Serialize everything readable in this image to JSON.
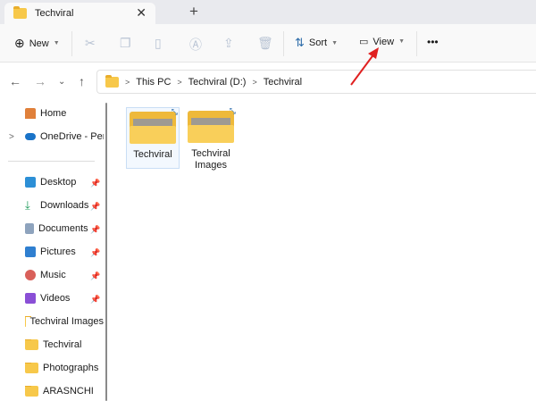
{
  "tab": {
    "title": "Techviral",
    "close": "✕",
    "new_tab": "+"
  },
  "toolbar": {
    "new": "New",
    "sort": "Sort",
    "view": "View",
    "more": "•••"
  },
  "address": {
    "path": [
      "This PC",
      "Techviral (D:)",
      "Techviral"
    ]
  },
  "sidebar": {
    "items": [
      {
        "label": "Home",
        "icon": "home-icon",
        "pinned": false
      },
      {
        "label": "OneDrive - Personal",
        "icon": "cloud-icon",
        "pinned": false
      },
      {
        "label": "Desktop",
        "icon": "desktop-icon",
        "pinned": true
      },
      {
        "label": "Downloads",
        "icon": "download-icon",
        "pinned": true
      },
      {
        "label": "Documents",
        "icon": "document-icon",
        "pinned": true
      },
      {
        "label": "Pictures",
        "icon": "pictures-icon",
        "pinned": true
      },
      {
        "label": "Music",
        "icon": "music-icon",
        "pinned": true
      },
      {
        "label": "Videos",
        "icon": "videos-icon",
        "pinned": true
      },
      {
        "label": "Techviral Images",
        "icon": "folder-icon",
        "pinned": false
      },
      {
        "label": "Techviral",
        "icon": "folder-icon",
        "pinned": false
      },
      {
        "label": "Photographs",
        "icon": "folder-icon",
        "pinned": false
      },
      {
        "label": "ARASNCHI",
        "icon": "folder-icon",
        "pinned": false
      }
    ]
  },
  "files": [
    {
      "name": "Techviral",
      "selected": true
    },
    {
      "name": "Techviral Images",
      "selected": false
    }
  ],
  "colors": {
    "annotation_arrow": "#e02020",
    "folder": "#f7c84a"
  }
}
